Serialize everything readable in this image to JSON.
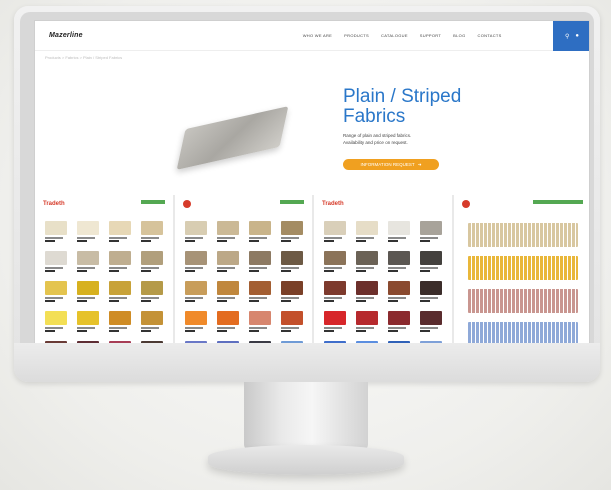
{
  "site": {
    "logo": "Mazerline",
    "nav": [
      "WHO WE ARE",
      "PRODUCTS",
      "CATALOGUE",
      "SUPPORT",
      "BLOG",
      "CONTACTS"
    ],
    "breadcrumb": "Products > Fabrics > Plain / Striped Fabrics"
  },
  "hero": {
    "title": "Plain / Striped\nFabrics",
    "subtitle": "Range of plain and striped fabrics.\nAvailability and price on request.",
    "cta": "INFORMATION REQUEST"
  },
  "panels": [
    {
      "title": "Tradeth",
      "swatches": [
        "#e8e0c8",
        "#efe7d2",
        "#e7d8b6",
        "#d6c39b",
        "#dedad2",
        "#c8bca5",
        "#bfae90",
        "#b19f7c",
        "#e4c44e",
        "#d7b11f",
        "#c8a238",
        "#b59a48",
        "#f3df55",
        "#e6c22a",
        "#cf8c25",
        "#c49237",
        "#6a3b36",
        "#5e2d33",
        "#a73d55",
        "#4c3a33"
      ]
    },
    {
      "title": "",
      "swatches": [
        "#d8cdb2",
        "#cbb996",
        "#c9b48a",
        "#a48c63",
        "#a79377",
        "#bca887",
        "#8d7a63",
        "#6d5a45",
        "#c89d5a",
        "#c0873d",
        "#a35e32",
        "#7a4028",
        "#f08a2a",
        "#e36c20",
        "#d7866e",
        "#c3502b",
        "#6a78c7",
        "#5e6fc0",
        "#3a3a44",
        "#6f9bd6"
      ]
    },
    {
      "title": "Tradeth",
      "swatches": [
        "#d9cfb9",
        "#e6ddc7",
        "#e7e5df",
        "#a8a39a",
        "#8b7359",
        "#6b6256",
        "#5b5752",
        "#44413e",
        "#7d3a2d",
        "#6c2f2b",
        "#8a4a2f",
        "#3b2d2a",
        "#d7262a",
        "#b6292d",
        "#8b2a2e",
        "#5a2c2e",
        "#3f6ecb",
        "#5b8ee0",
        "#2f61b8",
        "#7ea0d8"
      ]
    },
    {
      "title": "",
      "stripes": [
        "#d8c7a0",
        "#e9b73a",
        "#c99690",
        "#8fa9d8"
      ]
    }
  ]
}
